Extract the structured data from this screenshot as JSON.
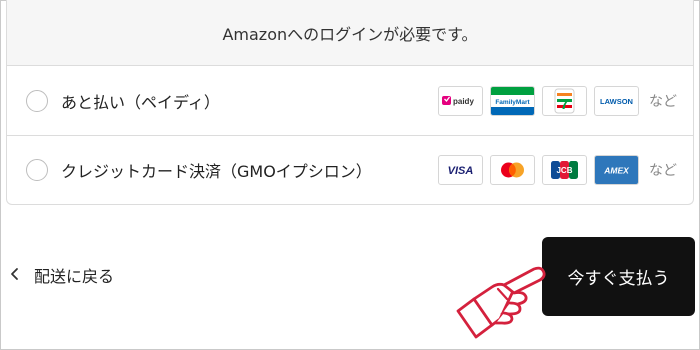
{
  "notice": {
    "text": "Amazonへのログインが必要です。"
  },
  "options": [
    {
      "label": "あと払い（ペイディ）",
      "logos": [
        {
          "name": "paidy",
          "text": "paidy"
        },
        {
          "name": "familymart",
          "text": "FamilyMart"
        },
        {
          "name": "seven-eleven",
          "text": "7"
        },
        {
          "name": "lawson",
          "text": "LAWSON"
        }
      ],
      "more": "など"
    },
    {
      "label": "クレジットカード決済（GMOイプシロン）",
      "logos": [
        {
          "name": "visa",
          "text": "VISA"
        },
        {
          "name": "mastercard",
          "text": "mastercard"
        },
        {
          "name": "jcb",
          "text": "JCB"
        },
        {
          "name": "amex",
          "text": "AMEX"
        }
      ],
      "more": "など"
    }
  ],
  "back": {
    "label": "配送に戻る"
  },
  "pay_button": {
    "label": "今すぐ支払う"
  },
  "colors": {
    "button_bg": "#111111",
    "hand": "#d4213d",
    "paidy": "#e5007f",
    "familymart_green": "#00a040",
    "familymart_blue": "#0068b7",
    "lawson": "#005bac",
    "visa": "#1a1f71",
    "amex": "#2e77bb"
  }
}
